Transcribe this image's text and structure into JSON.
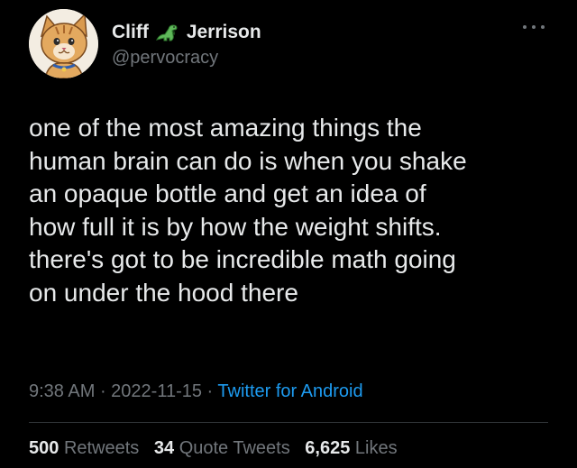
{
  "author": {
    "name_first": "Cliff",
    "name_last": "Jerrison",
    "handle": "@pervocracy",
    "name_emoji_icon": "dinosaur-icon",
    "avatar_icon": "cartoon-cat-avatar"
  },
  "tweet": {
    "lines": [
      "one of the most amazing things the",
      "human brain can do is when you shake",
      "an opaque bottle and get an idea of",
      "how full it is by how the weight shifts.",
      "there's got to be incredible math going",
      "on under the hood there"
    ]
  },
  "meta": {
    "time": "9:38 AM",
    "separator": " · ",
    "date": "2022-11-15",
    "source": "Twitter for Android"
  },
  "stats": {
    "retweets_count": "500",
    "retweets_label": "Retweets",
    "quotes_count": "34",
    "quotes_label": "Quote Tweets",
    "likes_count": "6,625",
    "likes_label": "Likes"
  },
  "colors": {
    "background": "#000000",
    "text_primary": "#e7e9ea",
    "text_secondary": "#71767b",
    "link": "#1d9bf0",
    "divider": "#2f3336"
  }
}
